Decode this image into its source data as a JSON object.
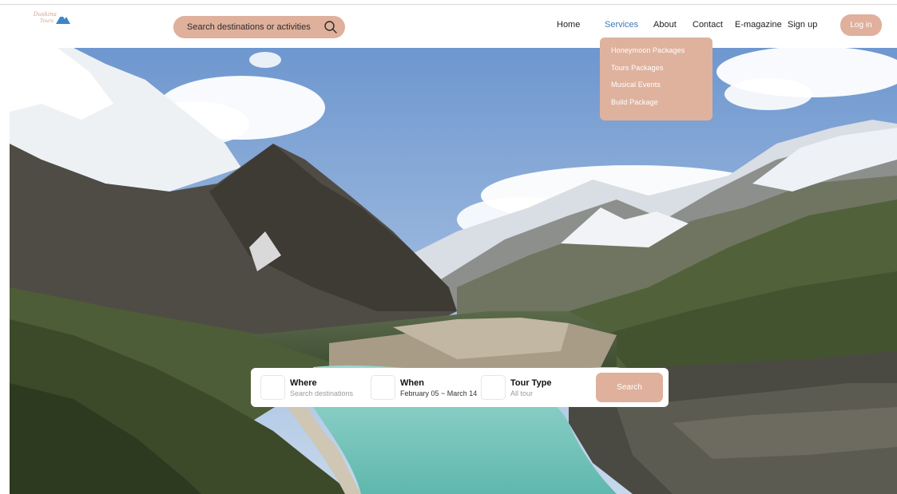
{
  "header": {
    "logo": {
      "line1": "Duskina",
      "line2": "Tours"
    },
    "search": {
      "placeholder": "Search destinations or activities"
    },
    "nav": [
      "Home",
      "Services",
      "About",
      "Contact",
      "E-magazine",
      "Sign up"
    ],
    "active_nav": "Services",
    "login_label": "Log in"
  },
  "services_menu": {
    "items": [
      "Honeymoon Packages",
      "Tours Packages",
      "Musical Events",
      "Build Package"
    ]
  },
  "booking": {
    "where": {
      "label": "Where",
      "value": "Search destinations"
    },
    "when": {
      "label": "When",
      "value": "February 05 ~ March 14"
    },
    "tour_type": {
      "label": "Tour Type",
      "value": "All tour"
    },
    "search_label": "Search"
  },
  "colors": {
    "accent": "#dfb09b",
    "active_link": "#3f7ab8",
    "lake": "#7cc7bd"
  },
  "icons": {
    "search": "search-icon",
    "logo": "mountain-logo-icon"
  }
}
